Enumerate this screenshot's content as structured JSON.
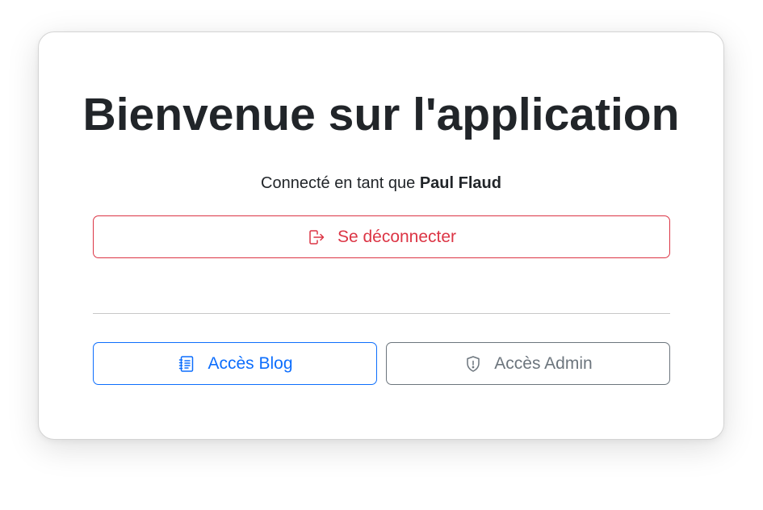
{
  "main": {
    "title": "Bienvenue sur l'application",
    "status_prefix": "Connecté en tant que",
    "username": "Paul Flaud"
  },
  "actions": {
    "logout_label": "Se déconnecter",
    "logout_icon": "box-arrow-right-icon",
    "blog_label": "Accès Blog",
    "blog_icon": "journal-text-icon",
    "admin_label": "Accès Admin",
    "admin_icon": "shield-exclamation-icon"
  },
  "colors": {
    "danger": "#dc3545",
    "primary": "#0d6efd",
    "secondary": "#6c757d",
    "text": "#212529"
  }
}
